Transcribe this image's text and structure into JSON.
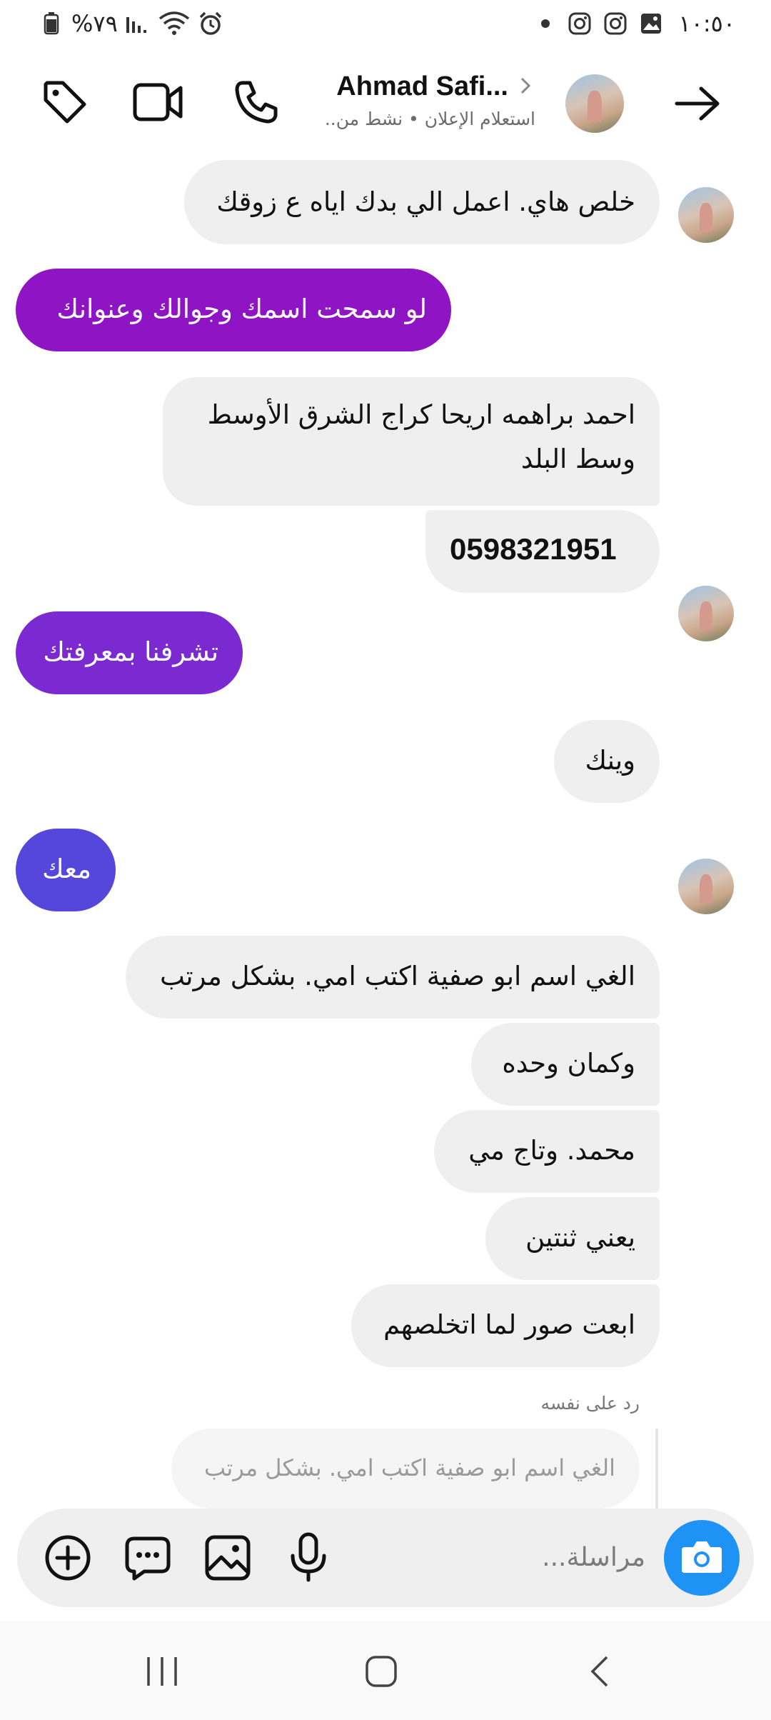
{
  "status_bar": {
    "time": "١٠:٥٠",
    "battery": "%٧٩"
  },
  "header": {
    "contact_name": "Ahmad Safi...",
    "subtitle": "استعلام الإعلان • نشط من..",
    "icons": [
      "tag-icon",
      "video-call-icon",
      "phone-icon",
      "chevron-right-icon",
      "back-arrow-icon"
    ]
  },
  "messages": [
    {
      "from": "them",
      "text": "خلص هاي. اعمل الي بدك اياه ع زوقك"
    },
    {
      "from": "me",
      "text": "لو سمحت اسمك وجوالك وعنوانك",
      "color": "#8f14c4"
    },
    {
      "from": "them",
      "text": "احمد براهمه اريحا كراج الشرق الأوسط وسط البلد"
    },
    {
      "from": "them",
      "text": "0598321951"
    },
    {
      "from": "me",
      "text": "تشرفنا بمعرفتك",
      "color": "#7a2ad0"
    },
    {
      "from": "them",
      "text": "وينك"
    },
    {
      "from": "me",
      "text": "معك",
      "color": "#5546dc"
    },
    {
      "from": "them",
      "text": "الغي اسم ابو صفية اكتب امي. بشكل مرتب"
    },
    {
      "from": "them",
      "text": "وكمان وحده"
    },
    {
      "from": "them",
      "text": "محمد. وتاج مي"
    },
    {
      "from": "them",
      "text": "يعني ثنتين"
    },
    {
      "from": "them",
      "text": "ابعت صور لما اتخلصهم"
    }
  ],
  "reply": {
    "label": "رد على نفسه",
    "quoted": "الغي اسم ابو صفية اكتب امي. بشكل مرتب"
  },
  "composer": {
    "placeholder": "مراسلة...",
    "icons": [
      "add-icon",
      "sticker-icon",
      "gallery-icon",
      "microphone-icon",
      "camera-icon"
    ]
  },
  "nav_bar": {
    "icons": [
      "recents-icon",
      "home-icon",
      "back-icon"
    ]
  }
}
